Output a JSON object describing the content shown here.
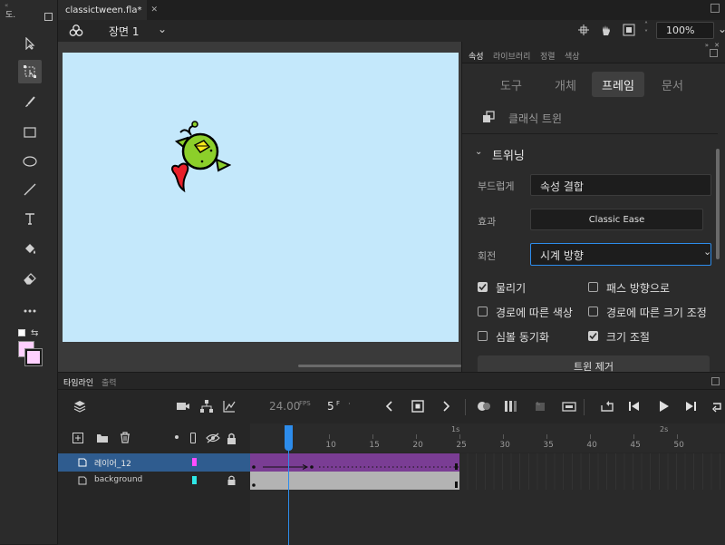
{
  "app": {
    "panel_title_left": "도."
  },
  "document": {
    "tab_title": "classictween.fla*",
    "close_glyph": "✕"
  },
  "scene": {
    "label": "장면 1",
    "zoom": "100%"
  },
  "properties": {
    "tabs": [
      "속성",
      "라이브러리",
      "정렬",
      "색상"
    ],
    "segments": [
      "도구",
      "개체",
      "프레임",
      "문서"
    ],
    "active_segment": "프레임",
    "tween_type": "클래식 트윈",
    "section_title": "트위닝",
    "ease_label": "부드럽게",
    "ease_value": "속성 결합",
    "effect_label": "효과",
    "effect_button": "Classic Ease",
    "rotate_label": "회전",
    "rotate_value": "시계 방향",
    "checkboxes": [
      {
        "label": "물리기",
        "checked": true
      },
      {
        "label": "패스 방향으로",
        "checked": false
      },
      {
        "label": "경로에 따른 색상",
        "checked": false
      },
      {
        "label": "경로에 따른 크기 조정",
        "checked": false
      },
      {
        "label": "심볼 동기화",
        "checked": false
      },
      {
        "label": "크기 조절",
        "checked": true
      }
    ],
    "cut_button": "트윈 제거"
  },
  "timeline": {
    "tabs": [
      "타임라인",
      "출력"
    ],
    "fps": "24.00",
    "fps_unit": "FPS",
    "frame": "5",
    "frame_unit": "F",
    "ruler_ticks": [
      "10",
      "15",
      "20",
      "25",
      "30",
      "35",
      "40",
      "45",
      "50"
    ],
    "seconds_marks": [
      "1s",
      "2s"
    ],
    "layers": [
      {
        "name": "레이어_12",
        "color": "#ff4dff",
        "selected": true
      },
      {
        "name": "background",
        "color": "#2ee6e6",
        "selected": false
      }
    ]
  },
  "colors": {
    "accent": "#2d8ceb",
    "tween_span": "#7a3d94",
    "stage": "#c4e8fb",
    "stroke_swatch": "#ffd0ff"
  }
}
